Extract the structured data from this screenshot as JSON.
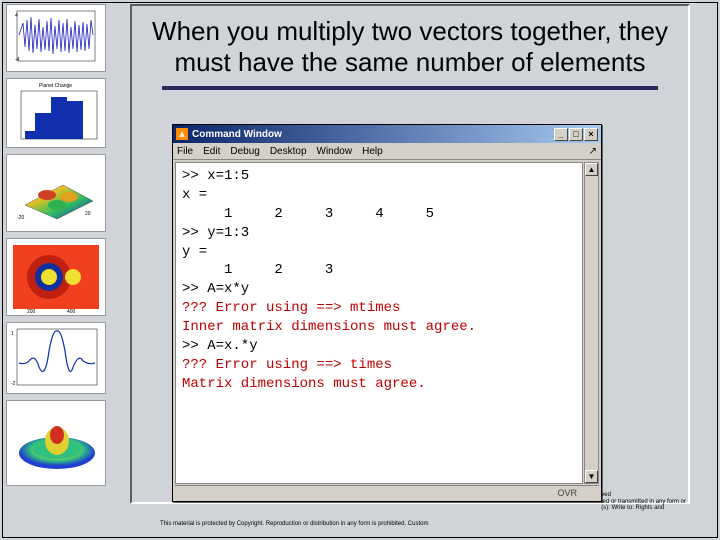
{
  "title": "When you multiply two vectors together, they must have the same number of elements",
  "cmdwin": {
    "title": "Command Window",
    "menus": {
      "file": "File",
      "edit": "Edit",
      "debug": "Debug",
      "desktop": "Desktop",
      "window": "Window",
      "help": "Help"
    },
    "min": "_",
    "max": "□",
    "close": "×",
    "hook": "↗",
    "status": "OVR",
    "lines": [
      {
        "t": ">> x=1:5",
        "err": false
      },
      {
        "t": "x =",
        "err": false
      },
      {
        "t": "     1     2     3     4     5",
        "err": false
      },
      {
        "t": ">> y=1:3",
        "err": false
      },
      {
        "t": "y =",
        "err": false
      },
      {
        "t": "     1     2     3",
        "err": false
      },
      {
        "t": ">> A=x*y",
        "err": false
      },
      {
        "t": "??? Error using ==> mtimes",
        "err": true
      },
      {
        "t": "Inner matrix dimensions must agree.",
        "err": true
      },
      {
        "t": "",
        "err": false
      },
      {
        "t": ">> A=x.*y",
        "err": false
      },
      {
        "t": "??? Error using ==> times",
        "err": true
      },
      {
        "t": "Matrix dimensions must agree.",
        "err": true
      }
    ]
  },
  "thumb_labels": {
    "t2": "Planet Change"
  },
  "footnote": "This material is protected by Copyright. Reproduction or distribution in any form is prohibited. Custom",
  "right_footnote_1": "ved",
  "right_footnote_2": "ied or transmitted in any form or",
  "right_footnote_3": "(s): Write to: Rights and"
}
